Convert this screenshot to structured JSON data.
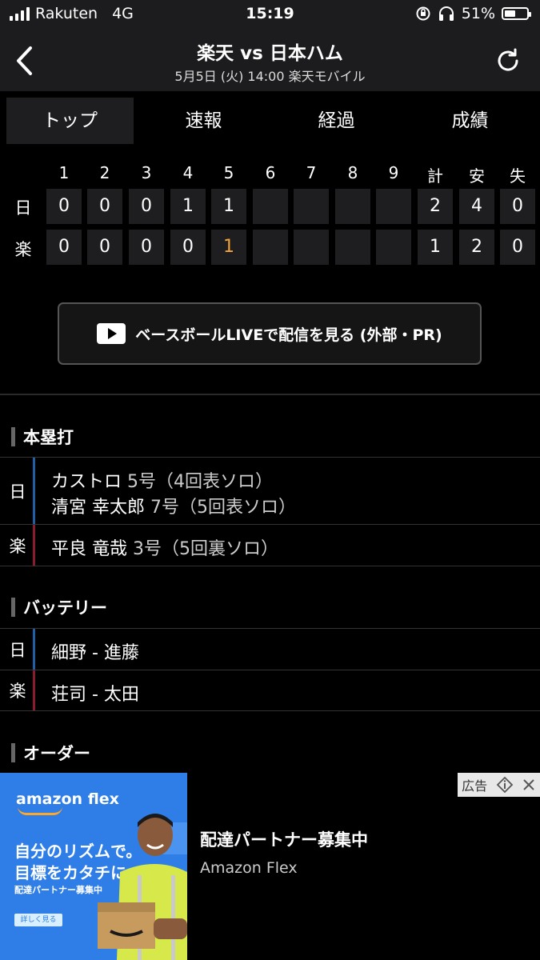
{
  "status": {
    "carrier": "Rakuten",
    "network": "4G",
    "time": "15:19",
    "battery": "51%",
    "battery_level": 0.51
  },
  "nav": {
    "title": "楽天 vs 日本ハム",
    "subtitle": "5月5日 (火) 14:00 楽天モバイル"
  },
  "tabs": [
    {
      "label": "トップ",
      "active": true
    },
    {
      "label": "速報"
    },
    {
      "label": "経過"
    },
    {
      "label": "成績"
    }
  ],
  "scoreboard": {
    "headers": [
      "1",
      "2",
      "3",
      "4",
      "5",
      "6",
      "7",
      "8",
      "9",
      "計",
      "安",
      "失"
    ],
    "rows": [
      {
        "team": "日",
        "innings": [
          "0",
          "0",
          "0",
          "1",
          "1",
          "",
          "",
          "",
          ""
        ],
        "totals": [
          "2",
          "4",
          "0"
        ]
      },
      {
        "team": "楽",
        "innings": [
          "0",
          "0",
          "0",
          "0",
          "1",
          "",
          "",
          "",
          ""
        ],
        "totals": [
          "1",
          "2",
          "0"
        ]
      }
    ],
    "highlight_color": "#f2a33a"
  },
  "live_button": {
    "label": "ベースボールLIVEで配信を見る (外部・PR)"
  },
  "homeruns": {
    "title": "本塁打",
    "entries": [
      {
        "team": "日",
        "lines": [
          {
            "name": "カストロ",
            "detail": "5号（4回表ソロ）"
          },
          {
            "name": "清宮 幸太郎",
            "detail": "7号（5回表ソロ）"
          }
        ]
      },
      {
        "team": "楽",
        "lines": [
          {
            "name": "平良 竜哉",
            "detail": "3号（5回裏ソロ）"
          }
        ]
      }
    ]
  },
  "battery_section": {
    "title": "バッテリー",
    "entries": [
      {
        "team": "日",
        "text": "細野 - 進藤"
      },
      {
        "team": "楽",
        "text": "荘司 - 太田"
      }
    ]
  },
  "order_section": {
    "title": "オーダー"
  },
  "colors": {
    "team_nichi": "#1f5fa8",
    "team_raku": "#8a1a2e",
    "ad_blue": "#2f7ee8"
  },
  "ad": {
    "badge": "広告",
    "logo": "amazon flex",
    "headline1": "自分のリズムで。",
    "headline2": "目標をカタチに。",
    "small": "配達パートナー募集中",
    "cta": "詳しく見る",
    "title": "配達パートナー募集中",
    "advertiser": "Amazon Flex"
  }
}
